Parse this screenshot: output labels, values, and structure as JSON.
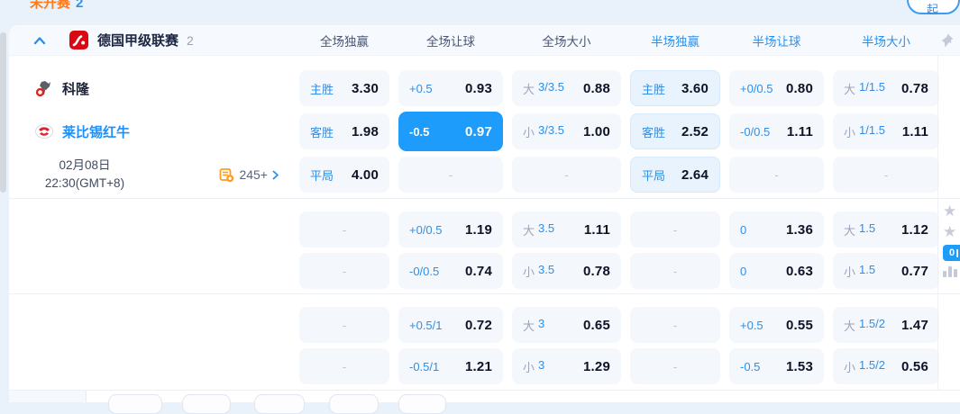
{
  "top_bar": {
    "status_label": "未开赛",
    "status_count": "2",
    "collapse_button": "收起"
  },
  "league_header": {
    "name": "德国甲级联赛",
    "match_count": "2",
    "columns": [
      "全场独赢",
      "全场让球",
      "全场大小",
      "半场独赢",
      "半场让球",
      "半场大小"
    ]
  },
  "match": {
    "home_team": "科隆",
    "away_team": "莱比锡红牛",
    "date": "02月08日",
    "time": "22:30(GMT+8)",
    "markets_count": "245+"
  },
  "ui": {
    "dash": "-",
    "live_badge_text": "0"
  },
  "colors": {
    "accent_blue": "#1e9cfb",
    "label_blue": "#2f8fe8",
    "status_orange": "#ff7a1a",
    "value_dark": "#0d1326",
    "cell_bg": "#f4f7fb",
    "half_cell_bg": "#e9f3fd"
  },
  "odds_rows": [
    {
      "cells": [
        {
          "l": "主胜",
          "v": "3.30"
        },
        {
          "l": "+0.5",
          "v": "0.93"
        },
        {
          "g": "大",
          "l": "3/3.5",
          "v": "0.88"
        },
        {
          "l": "主胜",
          "v": "3.60",
          "t": "half"
        },
        {
          "l": "+0/0.5",
          "v": "0.80"
        },
        {
          "g": "大",
          "l": "1/1.5",
          "v": "0.78"
        }
      ]
    },
    {
      "cells": [
        {
          "l": "客胜",
          "v": "1.98"
        },
        {
          "l": "-0.5",
          "v": "0.97",
          "t": "sel"
        },
        {
          "g": "小",
          "l": "3/3.5",
          "v": "1.00"
        },
        {
          "l": "客胜",
          "v": "2.52",
          "t": "half"
        },
        {
          "l": "-0/0.5",
          "v": "1.11"
        },
        {
          "g": "小",
          "l": "1/1.5",
          "v": "1.11"
        }
      ]
    },
    {
      "cells": [
        {
          "l": "平局",
          "v": "4.00"
        },
        {
          "t": "empty"
        },
        {
          "t": "empty"
        },
        {
          "l": "平局",
          "v": "2.64",
          "t": "half"
        },
        {
          "t": "empty"
        },
        {
          "t": "empty"
        }
      ]
    },
    {
      "cells": [
        {
          "t": "empty"
        },
        {
          "l": "+0/0.5",
          "v": "1.19"
        },
        {
          "g": "大",
          "l": "3.5",
          "v": "1.11"
        },
        {
          "t": "empty"
        },
        {
          "l": "0",
          "v": "1.36"
        },
        {
          "g": "大",
          "l": "1.5",
          "v": "1.12"
        }
      ]
    },
    {
      "cells": [
        {
          "t": "empty"
        },
        {
          "l": "-0/0.5",
          "v": "0.74"
        },
        {
          "g": "小",
          "l": "3.5",
          "v": "0.78"
        },
        {
          "t": "empty"
        },
        {
          "l": "0",
          "v": "0.63"
        },
        {
          "g": "小",
          "l": "1.5",
          "v": "0.77"
        }
      ]
    },
    {
      "cells": [
        {
          "t": "empty"
        },
        {
          "l": "+0.5/1",
          "v": "0.72"
        },
        {
          "g": "大",
          "l": "3",
          "v": "0.65"
        },
        {
          "t": "empty"
        },
        {
          "l": "+0.5",
          "v": "0.55"
        },
        {
          "g": "大",
          "l": "1.5/2",
          "v": "1.47"
        }
      ]
    },
    {
      "cells": [
        {
          "t": "empty"
        },
        {
          "l": "-0.5/1",
          "v": "1.21"
        },
        {
          "g": "小",
          "l": "3",
          "v": "1.29"
        },
        {
          "t": "empty"
        },
        {
          "l": "-0.5",
          "v": "1.53"
        },
        {
          "g": "小",
          "l": "1.5/2",
          "v": "0.56"
        }
      ]
    }
  ]
}
